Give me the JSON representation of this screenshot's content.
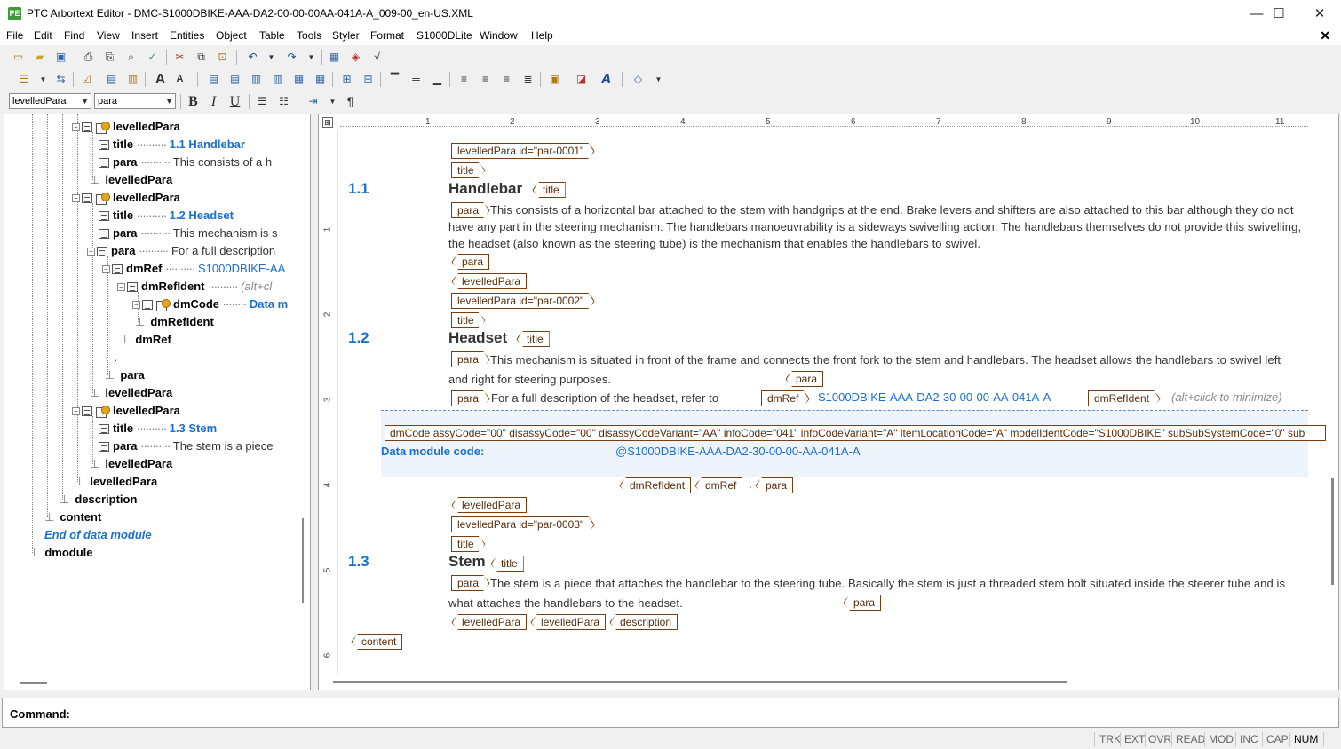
{
  "window": {
    "title": "PTC Arbortext Editor - DMC-S1000DBIKE-AAA-DA2-00-00-00AA-041A-A_009-00_en-US.XML",
    "app_icon": "arbortext-icon",
    "controls": {
      "minimize": "—",
      "maximize": "☐",
      "close": "✕"
    }
  },
  "menu": [
    "File",
    "Edit",
    "Find",
    "View",
    "Insert",
    "Entities",
    "Object",
    "Table",
    "Tools",
    "Styler",
    "Format",
    "S1000DLite",
    "Window",
    "Help"
  ],
  "doc_close": "✕",
  "toolbar": {
    "element_combo": "levelledPara",
    "style_combo": "para",
    "bold": "B",
    "italic": "I",
    "underline": "U",
    "pilcrow": "¶"
  },
  "tree": [
    {
      "name": "levelledPara",
      "value": "",
      "kind": "gold"
    },
    {
      "name": "title",
      "num": "1.1",
      "value": "Handlebar",
      "kind": "title"
    },
    {
      "name": "para",
      "value": "This consists of a h",
      "kind": "para"
    },
    {
      "name": "levelledPara",
      "value": "",
      "kind": "end"
    },
    {
      "name": "levelledPara",
      "value": "",
      "kind": "gold"
    },
    {
      "name": "title",
      "num": "1.2",
      "value": "Headset",
      "kind": "title"
    },
    {
      "name": "para",
      "value": "This mechanism is s",
      "kind": "para"
    },
    {
      "name": "para",
      "value": "For a full description",
      "kind": "para-exp"
    },
    {
      "name": "dmRef",
      "value": "S1000DBIKE-AA",
      "kind": "dmref"
    },
    {
      "name": "dmRefIdent",
      "value": "(alt+cl",
      "kind": "dmrefident"
    },
    {
      "name": "dmCode",
      "value": "Data m",
      "kind": "dmcode"
    },
    {
      "name": "dmRefIdent",
      "value": "",
      "kind": "end"
    },
    {
      "name": "dmRef",
      "value": "",
      "kind": "end"
    },
    {
      "name": ".",
      "value": "",
      "kind": "dot"
    },
    {
      "name": "para",
      "value": "",
      "kind": "end"
    },
    {
      "name": "levelledPara",
      "value": "",
      "kind": "end"
    },
    {
      "name": "levelledPara",
      "value": "",
      "kind": "gold"
    },
    {
      "name": "title",
      "num": "1.3",
      "value": "Stem",
      "kind": "title"
    },
    {
      "name": "para",
      "value": "The stem is a piece",
      "kind": "para"
    },
    {
      "name": "levelledPara",
      "value": "",
      "kind": "end"
    },
    {
      "name": "levelledPara",
      "value": "",
      "kind": "end"
    },
    {
      "name": "description",
      "value": "",
      "kind": "end"
    },
    {
      "name": "content",
      "value": "",
      "kind": "end"
    },
    {
      "name": "End of data module",
      "value": "",
      "kind": "eodm"
    },
    {
      "name": "dmodule",
      "value": "",
      "kind": "end"
    }
  ],
  "ruler": {
    "marks": [
      "1",
      "2",
      "3",
      "4",
      "5",
      "6",
      "7",
      "8",
      "9",
      "10",
      "11"
    ],
    "vmarks": [
      "1",
      "2",
      "3",
      "4",
      "5",
      "6"
    ]
  },
  "doc": {
    "tag_levelledPara1": "levelledPara id=\"par-0001\"",
    "tag_levelledPara2": "levelledPara id=\"par-0002\"",
    "tag_levelledPara3": "levelledPara id=\"par-0003\"",
    "tag_title": "title",
    "tag_para": "para",
    "tag_levelledPara": "levelledPara",
    "tag_dmRef": "dmRef",
    "tag_dmRefIdent": "dmRefIdent",
    "tag_description": "description",
    "tag_content": "content",
    "dot": ".",
    "sec1": {
      "num": "1.1",
      "title": "Handlebar",
      "para": "This consists of a horizontal bar attached to the stem with handgrips at the end. Brake levers and shifters are also attached to this bar although they do not have any part in the steering mechanism. The handlebars manoeuvrability is a sideways swivelling action. The handlebars themselves do not provide this swivelling, the headset (also known as the steering tube) is the mechanism that enables the handlebars to swivel."
    },
    "sec2": {
      "num": "1.2",
      "title": "Headset",
      "para": "This mechanism is situated in front of the frame and connects the front fork to the stem and handlebars. The headset allows the handlebars to swivel left and right for steering purposes.",
      "para2_text": "For a full description of the headset, refer to",
      "dm_link": "S1000DBIKE-AAA-DA2-30-00-00-AA-041A-A",
      "hint": "(alt+click to minimize)"
    },
    "dmcode_tag": "dmCode assyCode=\"00\" disassyCode=\"00\" disassyCodeVariant=\"AA\" infoCode=\"041\" infoCodeVariant=\"A\" itemLocationCode=\"A\" modelIdentCode=\"S1000DBIKE\" subSubSystemCode=\"0\" sub",
    "dmcode_label": "Data module code:",
    "dmcode_value": "@S1000DBIKE-AAA-DA2-30-00-00-AA-041A-A",
    "sec3": {
      "num": "1.3",
      "title": "Stem",
      "para": "The stem is a piece that attaches the handlebar to the steering tube. Basically the stem is just a threaded stem bolt situated inside the steerer tube and is what attaches the handlebars to the headset."
    }
  },
  "command": {
    "label": "Command:"
  },
  "status": [
    "TRK",
    "EXT",
    "OVR",
    "READ",
    "MOD",
    "INC",
    "CAP",
    "NUM"
  ]
}
